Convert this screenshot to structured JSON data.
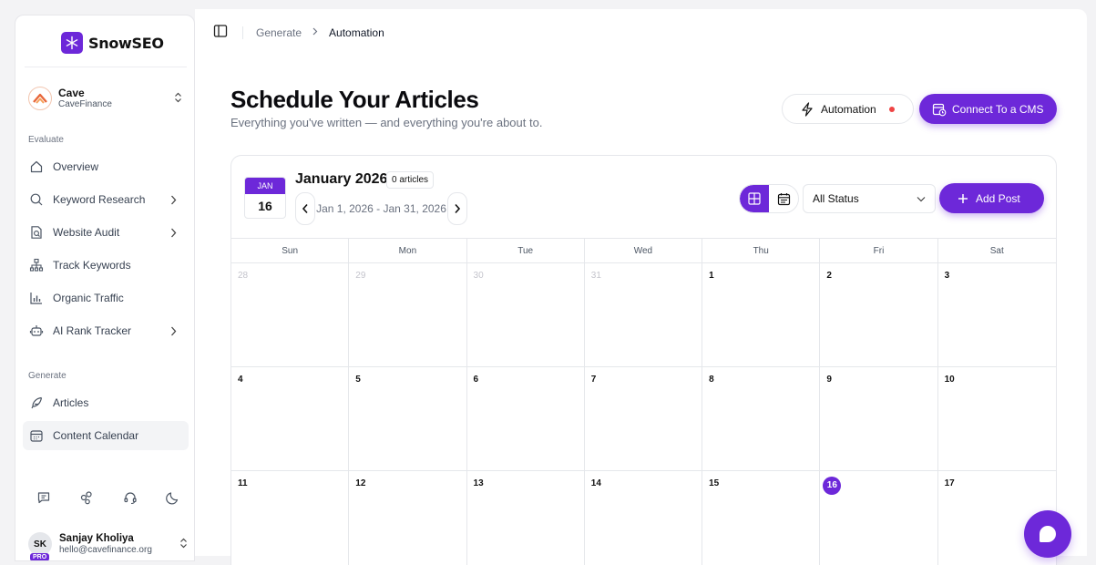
{
  "brand": {
    "name": "SnowSEO",
    "accent": "#6d28d9"
  },
  "workspace": {
    "name": "Cave",
    "subtitle": "CaveFinance"
  },
  "sidebar": {
    "sections": [
      {
        "title": "Evaluate"
      },
      {
        "title": "Generate"
      }
    ],
    "evaluate_items": [
      {
        "label": "Overview",
        "icon": "home-icon",
        "has_arrow": false
      },
      {
        "label": "Keyword Research",
        "icon": "search-icon",
        "has_arrow": true
      },
      {
        "label": "Website Audit",
        "icon": "audit-icon",
        "has_arrow": true
      },
      {
        "label": "Track Keywords",
        "icon": "hierarchy-icon",
        "has_arrow": false
      },
      {
        "label": "Organic Traffic",
        "icon": "bar-chart-icon",
        "has_arrow": false
      },
      {
        "label": "AI Rank Tracker",
        "icon": "robot-icon",
        "has_arrow": true
      }
    ],
    "generate_items": [
      {
        "label": "Articles",
        "icon": "feather-icon",
        "active": false
      },
      {
        "label": "Content Calendar",
        "icon": "calendar-icon",
        "active": true
      }
    ],
    "tools": [
      "chat-icon",
      "integrations-icon",
      "support-icon",
      "moon-icon"
    ]
  },
  "user": {
    "initials": "SK",
    "badge": "PRO",
    "name": "Sanjay Kholiya",
    "email": "hello@cavefinance.org"
  },
  "breadcrumb": {
    "items": [
      "Generate",
      "Automation"
    ]
  },
  "header": {
    "title": "Schedule Your Articles",
    "subtitle": "Everything you've written — and everything you're about to.",
    "automation_label": "Automation",
    "cms_label": "Connect To a CMS"
  },
  "calendar": {
    "badge_month": "JAN",
    "badge_day": "16",
    "month_title": "January 2026",
    "article_count": "0 articles",
    "range": "Jan 1, 2026 - Jan 31, 2026",
    "status_filter": "All Status",
    "add_post_label": "Add Post",
    "weekdays": [
      "Sun",
      "Mon",
      "Tue",
      "Wed",
      "Thu",
      "Fri",
      "Sat"
    ],
    "weeks": [
      [
        "28",
        "29",
        "30",
        "31",
        "1",
        "2",
        "3"
      ],
      [
        "4",
        "5",
        "6",
        "7",
        "8",
        "9",
        "10"
      ],
      [
        "11",
        "12",
        "13",
        "14",
        "15",
        "16",
        "17"
      ]
    ],
    "muted_days": [
      "28",
      "29",
      "30",
      "31"
    ],
    "today": "16"
  }
}
